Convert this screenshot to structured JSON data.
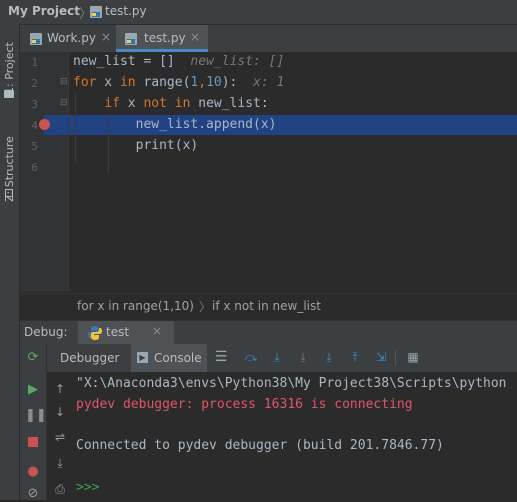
{
  "breadcrumb": {
    "project": "My Project",
    "separator": "〉",
    "file": "test.py"
  },
  "side_tabs": {
    "project": "1: Project",
    "structure": "Z: Structure"
  },
  "editor_tabs": [
    {
      "label": "Work.py",
      "close": "×"
    },
    {
      "label": "test.py",
      "close": "×"
    }
  ],
  "editor": {
    "line_numbers": [
      "1",
      "2",
      "3",
      "4",
      "5",
      "6"
    ],
    "lines": [
      {
        "tokens": [
          {
            "t": "new_list = []",
            "c": "plain"
          },
          {
            "t": "  new_list: []",
            "c": "hint"
          }
        ]
      },
      {
        "tokens": [
          {
            "t": "for",
            "c": "kw"
          },
          {
            "t": " x ",
            "c": "plain"
          },
          {
            "t": "in",
            "c": "kw"
          },
          {
            "t": " range(",
            "c": "plain"
          },
          {
            "t": "1",
            "c": "num"
          },
          {
            "t": ",",
            "c": "kw"
          },
          {
            "t": "10",
            "c": "num"
          },
          {
            "t": "):",
            "c": "plain"
          },
          {
            "t": "  x: 1",
            "c": "hint"
          }
        ]
      },
      {
        "tokens": [
          {
            "t": "    ",
            "c": "plain"
          },
          {
            "t": "if",
            "c": "kw"
          },
          {
            "t": " x ",
            "c": "plain"
          },
          {
            "t": "not in",
            "c": "kw"
          },
          {
            "t": " new_list:",
            "c": "plain"
          }
        ]
      },
      {
        "tokens": [
          {
            "t": "        new_list.append(x)",
            "c": "plain"
          }
        ]
      },
      {
        "tokens": [
          {
            "t": "        print(x)",
            "c": "plain"
          }
        ]
      },
      {
        "tokens": []
      }
    ],
    "highlighted_line": 4,
    "breakpoint_line": 4
  },
  "structure_path": {
    "first": "for x in range(1,10)",
    "arrow": "〉",
    "second": "if x not in new_list"
  },
  "debug": {
    "title": "Debug:",
    "run_tab": "test",
    "run_close": "×",
    "tabs": {
      "debugger": "Debugger",
      "console": "Console"
    },
    "console_lines": [
      {
        "text": "\"X:\\Anaconda3\\envs\\Python38\\My Project38\\Scripts\\python",
        "color": "#a9b7c6"
      },
      {
        "text": "pydev debugger: process 16316 is connecting",
        "color": "#e0556a"
      },
      {
        "text": "",
        "color": "#a9b7c6"
      },
      {
        "text": "Connected to pydev debugger (build 201.7846.77)",
        "color": "#a9b7c6"
      },
      {
        "text": "",
        "color": "#a9b7c6"
      },
      {
        "text": ">>>",
        "color": "#499c54"
      }
    ]
  },
  "colors": {
    "accent": "#4a88c7",
    "highlight": "#214283",
    "breakpoint": "#c75450",
    "error_text": "#e0556a",
    "prompt": "#499c54"
  }
}
